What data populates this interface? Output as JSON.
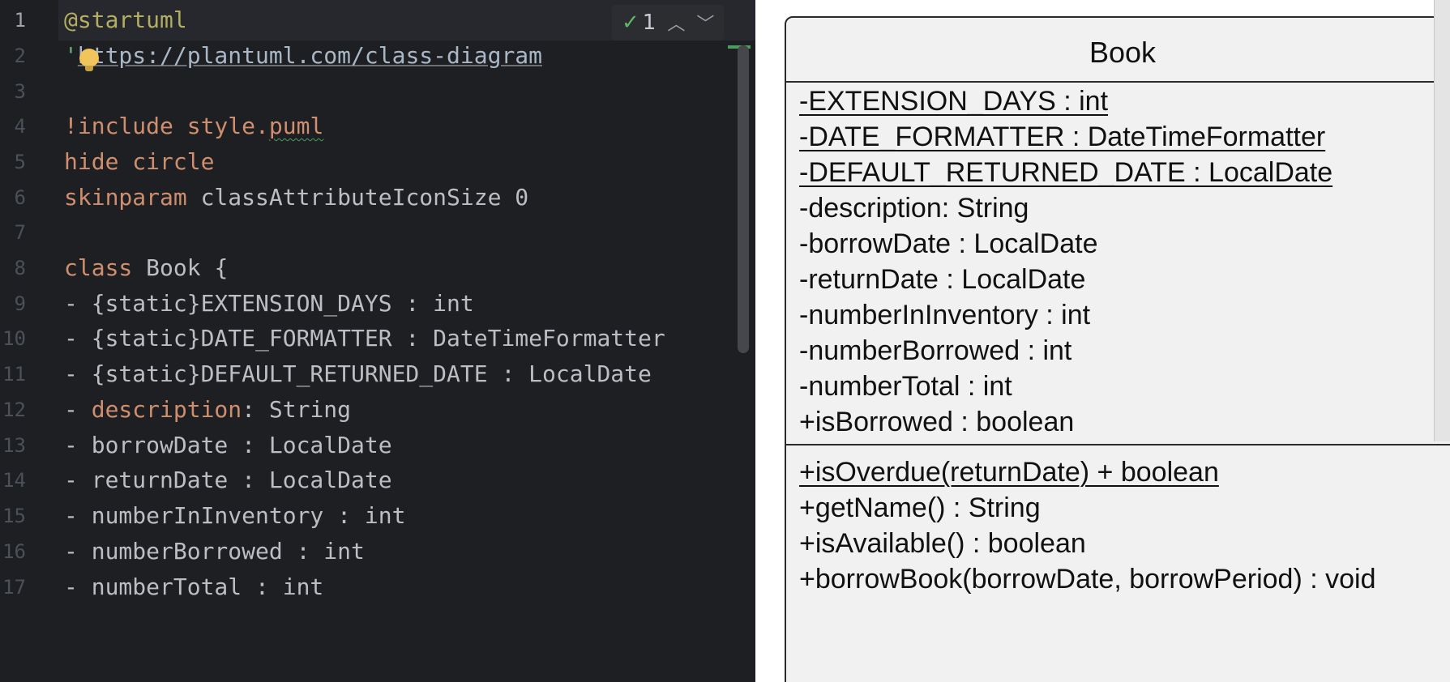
{
  "editor": {
    "line_numbers": [
      "1",
      "2",
      "3",
      "4",
      "5",
      "6",
      "7",
      "8",
      "9",
      "10",
      "11",
      "12",
      "13",
      "14",
      "15",
      "16",
      "17"
    ],
    "current_line": "1",
    "inspection": {
      "count": "1",
      "check_icon": "check-icon",
      "up_icon": "chevron-up-icon",
      "down_icon": "chevron-down-icon"
    },
    "code": {
      "l1": "@startuml",
      "l2_quote": "'",
      "l2_url": "https://plantuml.com/class-diagram",
      "l4_kw": "!include",
      "l4_file": " style.",
      "l4_ext": "puml",
      "l5_kw": "hide",
      "l5_rest": " circle",
      "l6_kw": "skinparam",
      "l6_rest": " classAttributeIconSize ",
      "l6_num": "0",
      "l8_kw": "class",
      "l8_rest": " Book {",
      "l9": "- {static}EXTENSION_DAYS : int",
      "l10": "- {static}DATE_FORMATTER : DateTimeFormatter",
      "l11": "- {static}DEFAULT_RETURNED_DATE : LocalDate",
      "l12_pre": "- ",
      "l12_field": "description",
      "l12_rest": ": String",
      "l13": "- borrowDate : LocalDate",
      "l14": "- returnDate : LocalDate",
      "l15": "- numberInInventory : int",
      "l16": "- numberBorrowed : int",
      "l17": "- numberTotal : int"
    }
  },
  "diagram": {
    "class_name": "Book",
    "attributes": [
      {
        "text": "-EXTENSION_DAYS : int",
        "static": true
      },
      {
        "text": "-DATE_FORMATTER : DateTimeFormatter",
        "static": true
      },
      {
        "text": "-DEFAULT_RETURNED_DATE : LocalDate",
        "static": true
      },
      {
        "text": "-description: String",
        "static": false
      },
      {
        "text": "-borrowDate : LocalDate",
        "static": false
      },
      {
        "text": "-returnDate : LocalDate",
        "static": false
      },
      {
        "text": "-numberInInventory : int",
        "static": false
      },
      {
        "text": "-numberBorrowed : int",
        "static": false
      },
      {
        "text": "-numberTotal : int",
        "static": false
      },
      {
        "text": "+isBorrowed : boolean",
        "static": false
      }
    ],
    "methods": [
      {
        "text": "+isOverdue(returnDate) + boolean",
        "static": true
      },
      {
        "text": "+getName() : String",
        "static": false
      },
      {
        "text": "+isAvailable() : boolean",
        "static": false
      },
      {
        "text": "+borrowBook(borrowDate, borrowPeriod) : void",
        "static": false
      }
    ]
  }
}
